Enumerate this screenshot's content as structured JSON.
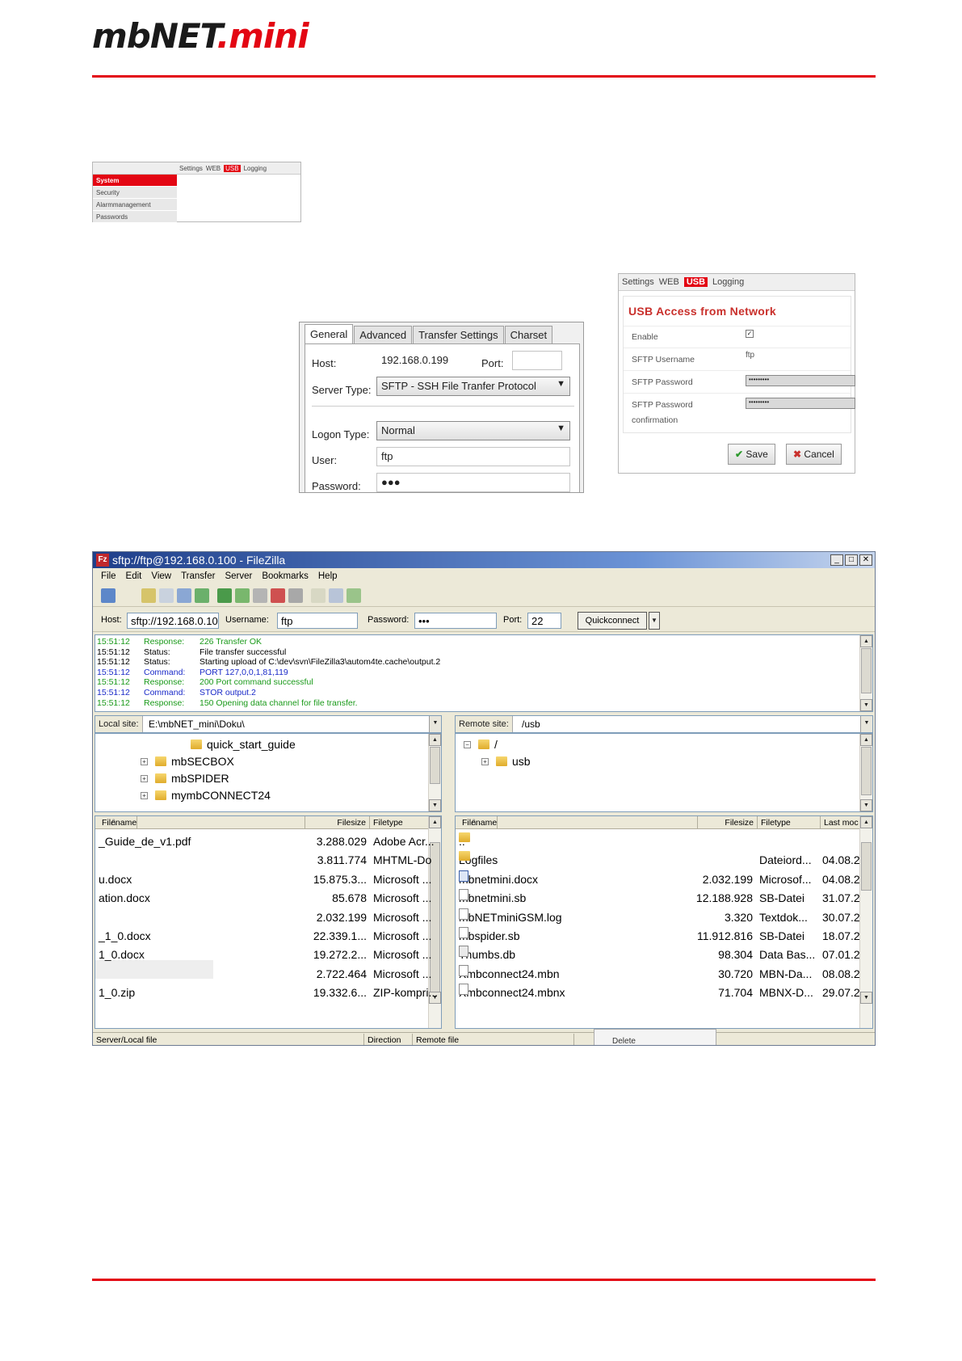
{
  "header": {
    "logo_main": "mbNET",
    "logo_accent": ".mini"
  },
  "settings_nav": {
    "tabs": [
      "Settings",
      "WEB",
      "USB",
      "Logging"
    ],
    "active_tab": "USB",
    "items": [
      "System",
      "Security",
      "Alarmmanagement",
      "Passwords"
    ],
    "active_item": "System"
  },
  "site_manager": {
    "tabs": [
      "General",
      "Advanced",
      "Transfer Settings",
      "Charset"
    ],
    "active_tab": "General",
    "host_label": "Host:",
    "host_value": "192.168.0.199",
    "port_label": "Port:",
    "port_value": "",
    "server_type_label": "Server Type:",
    "server_type_value": "SFTP - SSH File Tranfer Protocol",
    "logon_type_label": "Logon Type:",
    "logon_type_value": "Normal",
    "user_label": "User:",
    "user_value": "ftp",
    "password_label": "Password:",
    "password_value": "●●●"
  },
  "usb_access": {
    "tabs": [
      "Settings",
      "WEB",
      "USB",
      "Logging"
    ],
    "active_tab": "USB",
    "title": "USB Access from Network",
    "enable_label": "Enable",
    "enable_checked": "✓",
    "sftp_username_label": "SFTP Username",
    "sftp_username_value": "ftp",
    "sftp_password_label": "SFTP Password",
    "sftp_password_value": "•••••••••",
    "sftp_password_confirm_label_1": "SFTP Password",
    "sftp_password_confirm_label_2": "confirmation",
    "sftp_password_confirm_value": "•••••••••",
    "save_icon": "✔",
    "save_label": "Save",
    "cancel_icon": "✖",
    "cancel_label": "Cancel"
  },
  "filezilla": {
    "icon_label": "Fz",
    "title": "sftp://ftp@192.168.0.100 - FileZilla",
    "window_buttons": [
      "_",
      "□",
      "✕"
    ],
    "menu": [
      "File",
      "Edit",
      "View",
      "Transfer",
      "Server",
      "Bookmarks",
      "Help"
    ],
    "quickconnect": {
      "host_label": "Host:",
      "host_value": "sftp://192.168.0.10",
      "username_label": "Username:",
      "username_value": "ftp",
      "password_label": "Password:",
      "password_value": "•••",
      "port_label": "Port:",
      "port_value": "22",
      "button_label": "Quickconnect",
      "dropdown_glyph": "▼"
    },
    "log": [
      {
        "time": "15:51:12",
        "kind": "Response:",
        "msg": "226 Transfer OK",
        "color": "#1a9a1a"
      },
      {
        "time": "15:51:12",
        "kind": "Status:",
        "msg": "File transfer successful",
        "color": "#000000"
      },
      {
        "time": "15:51:12",
        "kind": "Status:",
        "msg": "Starting upload of C:\\dev\\svn\\FileZilla3\\autom4te.cache\\output.2",
        "color": "#000000"
      },
      {
        "time": "15:51:12",
        "kind": "Command:",
        "msg": "PORT 127,0,0,1,81,119",
        "color": "#1a2ac8"
      },
      {
        "time": "15:51:12",
        "kind": "Response:",
        "msg": "200 Port command successful",
        "color": "#1a9a1a"
      },
      {
        "time": "15:51:12",
        "kind": "Command:",
        "msg": "STOR output.2",
        "color": "#1a2ac8"
      },
      {
        "time": "15:51:12",
        "kind": "Response:",
        "msg": "150 Opening data channel for file transfer.",
        "color": "#1a9a1a"
      }
    ],
    "local": {
      "site_label": "Local site:",
      "site_value": "E:\\mbNET_mini\\Doku\\",
      "tree": [
        {
          "name": "quick_start_guide",
          "expander": ""
        },
        {
          "name": "mbSECBOX",
          "expander": "+"
        },
        {
          "name": "mbSPIDER",
          "expander": "+"
        },
        {
          "name": "mymbCONNECT24",
          "expander": "+"
        }
      ],
      "columns": [
        "Filename",
        "Filesize",
        "Filetype"
      ],
      "sort_glyph": "/\\",
      "files": [
        {
          "name": "_Guide_de_v1.pdf",
          "size": "3.288.029",
          "type": "Adobe Acr..."
        },
        {
          "name": "",
          "size": "3.811.774",
          "type": "MHTML-Do"
        },
        {
          "name": "u.docx",
          "size": "15.875.3...",
          "type": "Microsoft ..."
        },
        {
          "name": "ation.docx",
          "size": "85.678",
          "type": "Microsoft ..."
        },
        {
          "name": "",
          "size": "2.032.199",
          "type": "Microsoft ..."
        },
        {
          "name": "_1_0.docx",
          "size": "22.339.1...",
          "type": "Microsoft ..."
        },
        {
          "name": "1_0.docx",
          "size": "19.272.2...",
          "type": "Microsoft ..."
        },
        {
          "name": "",
          "size": "2.722.464",
          "type": "Microsoft ..."
        },
        {
          "name": "1_0.zip",
          "size": "19.332.6...",
          "type": "ZIP-kompri..."
        }
      ]
    },
    "remote": {
      "site_label": "Remote site:",
      "site_value": "/usb",
      "tree": [
        {
          "name": "/",
          "expander": "−"
        },
        {
          "name": "usb",
          "expander": "+"
        }
      ],
      "columns": [
        "Filename",
        "Filesize",
        "Filetype",
        "Last moc"
      ],
      "sort_glyph": "/\\",
      "files": [
        {
          "name": "..",
          "size": "",
          "type": "",
          "modified": "",
          "icon": "folder"
        },
        {
          "name": "Logfiles",
          "size": "",
          "type": "Dateiord...",
          "modified": "04.08.2",
          "icon": "folder"
        },
        {
          "name": "mbnetmini.docx",
          "size": "2.032.199",
          "type": "Microsof...",
          "modified": "04.08.2",
          "icon": "doc"
        },
        {
          "name": "mbnetmini.sb",
          "size": "12.188.928",
          "type": "SB-Datei",
          "modified": "31.07.2",
          "icon": "file"
        },
        {
          "name": "mbNETminiGSM.log",
          "size": "3.320",
          "type": "Textdok...",
          "modified": "30.07.2",
          "icon": "file"
        },
        {
          "name": "mbspider.sb",
          "size": "11.912.816",
          "type": "SB-Datei",
          "modified": "18.07.2",
          "icon": "file"
        },
        {
          "name": "Thumbs.db",
          "size": "98.304",
          "type": "Data Bas...",
          "modified": "07.01.2",
          "icon": "db"
        },
        {
          "name": "Xmbconnect24.mbn",
          "size": "30.720",
          "type": "MBN-Da...",
          "modified": "08.08.2",
          "icon": "file"
        },
        {
          "name": "Xmbconnect24.mbnx",
          "size": "71.704",
          "type": "MBNX-D...",
          "modified": "29.07.2",
          "icon": "file"
        }
      ]
    },
    "queue_columns": [
      "Server/Local file",
      "Direction",
      "Remote file"
    ],
    "context_menu_item": "Delete"
  }
}
